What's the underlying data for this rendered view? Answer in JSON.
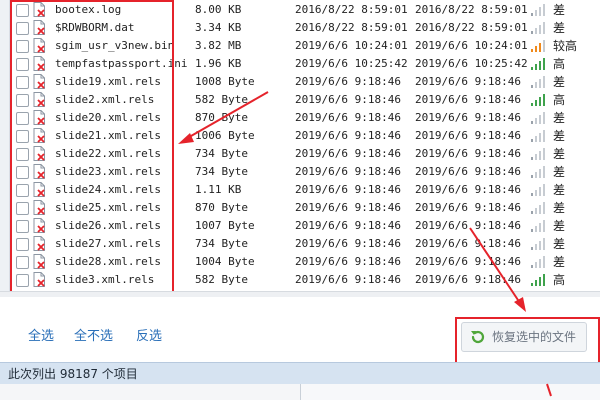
{
  "files": [
    {
      "name": "bootex.log",
      "size": "8.00 KB",
      "date1": "2016/8/22 8:59:01",
      "date2": "2016/8/22 8:59:01",
      "quality": "差",
      "signal": 1
    },
    {
      "name": "$RDWBORM.dat",
      "size": "3.34 KB",
      "date1": "2016/8/22 8:59:01",
      "date2": "2016/8/22 8:59:01",
      "quality": "差",
      "signal": 1
    },
    {
      "name": "sgim_usr_v3new.bin",
      "size": "3.82 MB",
      "date1": "2019/6/6 10:24:01",
      "date2": "2019/6/6 10:24:01",
      "quality": "较高",
      "signal": 3
    },
    {
      "name": "tempfastpassport.ini",
      "size": "1.96 KB",
      "date1": "2019/6/6 10:25:42",
      "date2": "2019/6/6 10:25:42",
      "quality": "高",
      "signal": 4
    },
    {
      "name": "slide19.xml.rels",
      "size": "1008 Byte",
      "date1": "2019/6/6 9:18:46",
      "date2": "2019/6/6 9:18:46",
      "quality": "差",
      "signal": 1
    },
    {
      "name": "slide2.xml.rels",
      "size": "582 Byte",
      "date1": "2019/6/6 9:18:46",
      "date2": "2019/6/6 9:18:46",
      "quality": "高",
      "signal": 4
    },
    {
      "name": "slide20.xml.rels",
      "size": "870 Byte",
      "date1": "2019/6/6 9:18:46",
      "date2": "2019/6/6 9:18:46",
      "quality": "差",
      "signal": 1
    },
    {
      "name": "slide21.xml.rels",
      "size": "1006 Byte",
      "date1": "2019/6/6 9:18:46",
      "date2": "2019/6/6 9:18:46",
      "quality": "差",
      "signal": 1
    },
    {
      "name": "slide22.xml.rels",
      "size": "734 Byte",
      "date1": "2019/6/6 9:18:46",
      "date2": "2019/6/6 9:18:46",
      "quality": "差",
      "signal": 1
    },
    {
      "name": "slide23.xml.rels",
      "size": "734 Byte",
      "date1": "2019/6/6 9:18:46",
      "date2": "2019/6/6 9:18:46",
      "quality": "差",
      "signal": 1
    },
    {
      "name": "slide24.xml.rels",
      "size": "1.11 KB",
      "date1": "2019/6/6 9:18:46",
      "date2": "2019/6/6 9:18:46",
      "quality": "差",
      "signal": 1
    },
    {
      "name": "slide25.xml.rels",
      "size": "870 Byte",
      "date1": "2019/6/6 9:18:46",
      "date2": "2019/6/6 9:18:46",
      "quality": "差",
      "signal": 1
    },
    {
      "name": "slide26.xml.rels",
      "size": "1007 Byte",
      "date1": "2019/6/6 9:18:46",
      "date2": "2019/6/6 9:18:46",
      "quality": "差",
      "signal": 1
    },
    {
      "name": "slide27.xml.rels",
      "size": "734 Byte",
      "date1": "2019/6/6 9:18:46",
      "date2": "2019/6/6 9:18:46",
      "quality": "差",
      "signal": 1
    },
    {
      "name": "slide28.xml.rels",
      "size": "1004 Byte",
      "date1": "2019/6/6 9:18:46",
      "date2": "2019/6/6 9:18:46",
      "quality": "差",
      "signal": 1
    },
    {
      "name": "slide3.xml.rels",
      "size": "582 Byte",
      "date1": "2019/6/6 9:18:46",
      "date2": "2019/6/6 9:18:46",
      "quality": "高",
      "signal": 4
    }
  ],
  "actions": {
    "select_all": "全选",
    "select_none": "全不选",
    "invert": "反选",
    "restore_button": "恢复选中的文件"
  },
  "status": {
    "text": "此次列出 98187 个项目"
  },
  "colors": {
    "annotation_red": "#e5232b",
    "signal_green": "#3fa34d",
    "signal_orange": "#f08a1c",
    "signal_gray": "#c7ccd2",
    "link_blue": "#2a6fb8",
    "status_bar": "#d6e3f1"
  },
  "icons": {
    "file": "deleted-file-icon",
    "restore": "restore-arrow-icon"
  }
}
